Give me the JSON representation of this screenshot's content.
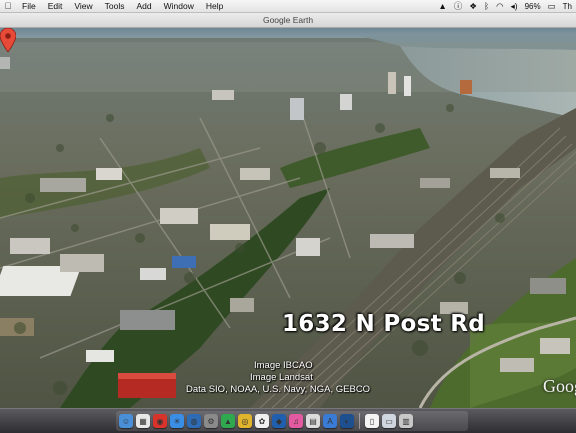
{
  "menubar": {
    "apple_icon": "apple-logo-icon",
    "items": [
      "File",
      "Edit",
      "View",
      "Tools",
      "Add",
      "Window",
      "Help"
    ],
    "status_icons": [
      "adobe-icon",
      "info-icon",
      "dropbox-icon",
      "bluetooth-icon",
      "wifi-icon",
      "volume-icon"
    ],
    "battery": "96%",
    "clock_fragment": "Th"
  },
  "window": {
    "title": "Google Earth"
  },
  "map": {
    "placemark_label": "1632 N Post Rd",
    "attribution": [
      "Image IBCAO",
      "Image Landsat",
      "Data SIO, NOAA, U.S. Navy, NGA, GEBCO"
    ],
    "brand": "Goog"
  },
  "dock": {
    "apps": [
      {
        "name": "finder-icon",
        "color": "#4a90d9",
        "glyph": "☺"
      },
      {
        "name": "calendar-icon",
        "color": "#e8e8e8",
        "glyph": "▦"
      },
      {
        "name": "app-red-icon",
        "color": "#d9342b",
        "glyph": "◉"
      },
      {
        "name": "safari-icon",
        "color": "#3a8ee6",
        "glyph": "✳"
      },
      {
        "name": "globe-icon",
        "color": "#2d6bb5",
        "glyph": "◍"
      },
      {
        "name": "settings-icon",
        "color": "#8a8a8a",
        "glyph": "⚙"
      },
      {
        "name": "drive-icon",
        "color": "#2fa84f",
        "glyph": "▲"
      },
      {
        "name": "chrome-icon",
        "color": "#e0b42c",
        "glyph": "◎"
      },
      {
        "name": "photos-icon",
        "color": "#f0f0f0",
        "glyph": "✿"
      },
      {
        "name": "app-blue-icon",
        "color": "#1f5fae",
        "glyph": "◆"
      },
      {
        "name": "itunes-icon",
        "color": "#e45aa0",
        "glyph": "♫"
      },
      {
        "name": "preview-icon",
        "color": "#dcdcdc",
        "glyph": "▤"
      },
      {
        "name": "app-store-icon",
        "color": "#3a7bd5",
        "glyph": "A"
      },
      {
        "name": "google-earth-icon",
        "color": "#1e4f8f",
        "glyph": "◐"
      }
    ],
    "docs": [
      {
        "name": "document-icon",
        "color": "#f4f4f4",
        "glyph": "▯"
      },
      {
        "name": "downloads-icon",
        "color": "#cfd6df",
        "glyph": "▭"
      },
      {
        "name": "trash-icon",
        "color": "#c8c8c8",
        "glyph": "▥"
      }
    ]
  }
}
